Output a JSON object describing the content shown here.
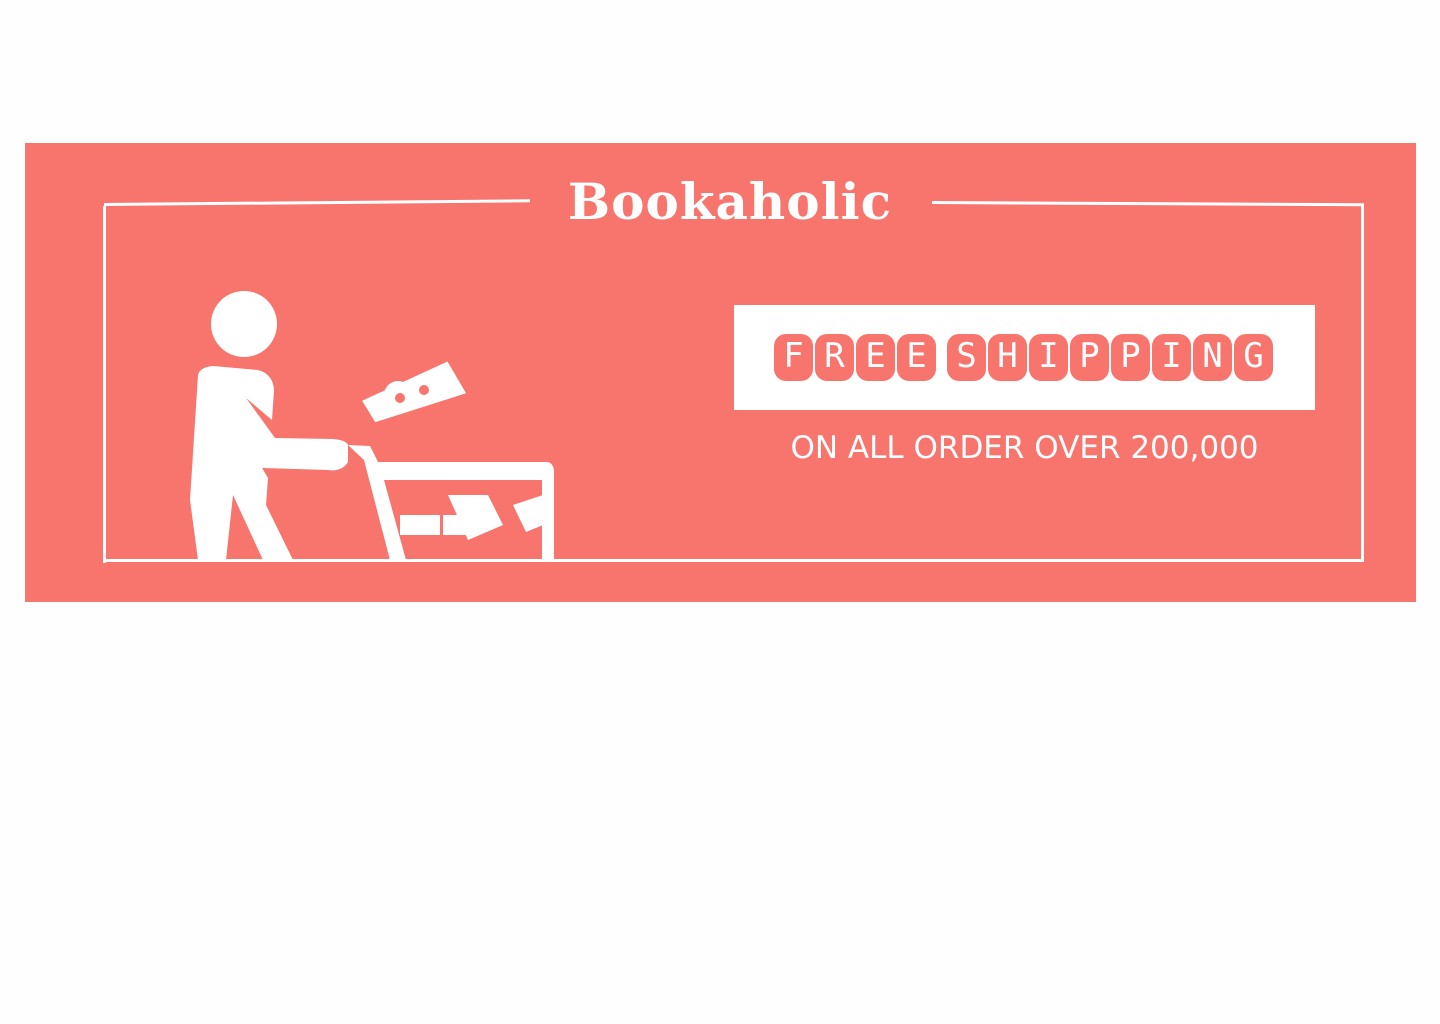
{
  "brand": {
    "title": "Bookaholic"
  },
  "promo": {
    "headline_words": [
      [
        "F",
        "R",
        "E",
        "E"
      ],
      [
        "S",
        "H",
        "I",
        "P",
        "P",
        "I",
        "N",
        "G"
      ]
    ],
    "headline": "FREE SHIPPING",
    "subtext": "ON ALL ORDER OVER 200,000"
  },
  "colors": {
    "background": "#f7756d",
    "foreground": "#ffffff"
  },
  "illustration": {
    "icon": "person-shopping-cart-gift-icon"
  }
}
